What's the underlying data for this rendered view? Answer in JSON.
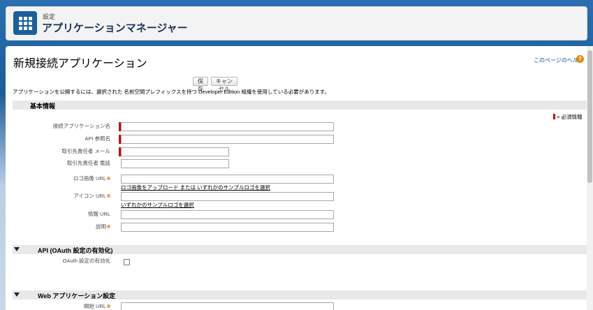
{
  "header": {
    "subtitle": "設定",
    "title": "アプリケーションマネージャー"
  },
  "page": {
    "title": "新規接続アプリケーション",
    "help_link": "このページのヘルプ",
    "save_button": "保存",
    "cancel_button": "キャンセル",
    "notice": "アプリケーションを公開するには、選択された 名前空間プレフィックスを持つ Developer Edition 組織を使用している必要があります。",
    "required_legend": "= 必須情報"
  },
  "sections": {
    "basic": {
      "title": "基本情報",
      "fields": {
        "app_name": {
          "label": "接続アプリケーション名",
          "value": ""
        },
        "api_name": {
          "label": "API 参照名",
          "value": ""
        },
        "contact_email": {
          "label": "取引先責任者 メール",
          "value": ""
        },
        "contact_phone": {
          "label": "取引先責任者 電話",
          "value": ""
        },
        "logo_url": {
          "label": "ロゴ画像 URL",
          "value": ""
        },
        "icon_url": {
          "label": "アイコン URL",
          "value": ""
        },
        "info_url": {
          "label": "情報 URL",
          "value": ""
        },
        "description": {
          "label": "説明",
          "value": ""
        }
      },
      "logo_links": {
        "upload": "ロゴ画像をアップロード",
        "or": " または ",
        "choose_sample": "いずれかのサンプルロゴを選択"
      },
      "icon_links": {
        "choose_sample": "いずれかのサンプルロゴを選択"
      }
    },
    "api": {
      "title": "API (OAuth 設定の有効化)",
      "oauth_label": "OAuth 設定の有効化",
      "oauth_checked": false
    },
    "web": {
      "title": "Web アプリケーション設定",
      "start_url_label": "開始 URL",
      "start_url_value": ""
    }
  },
  "colors": {
    "brand": "#1b5f9e",
    "required": "#cc0000",
    "link": "#015ba7"
  }
}
